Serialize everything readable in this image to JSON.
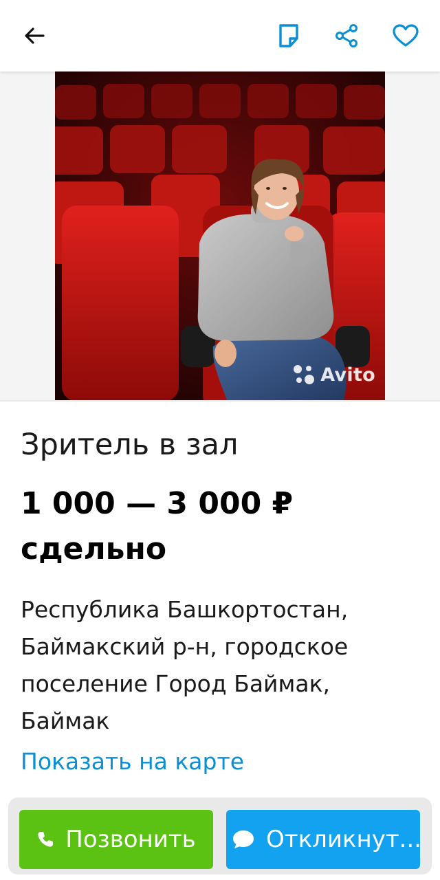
{
  "topbar": {
    "back_icon": "arrow-left-icon",
    "note_icon": "note-icon",
    "share_icon": "share-icon",
    "favorite_icon": "heart-icon",
    "accent_color": "#0a8ed4"
  },
  "photo": {
    "watermark": "Avito"
  },
  "listing": {
    "title": "Зритель в зал",
    "price": "1 000 — 3 000 ₽",
    "pay_type": "сдельно",
    "address_lines": [
      "Республика Башкортостан,",
      "Баймакский р-н, городское",
      "поселение Город Баймак,",
      "Баймак"
    ],
    "map_link": "Показать на карте"
  },
  "actions": {
    "call_label": "Позвонить",
    "reply_label": "Откликнут...",
    "call_color": "#5bc214",
    "reply_color": "#12a2f0"
  }
}
